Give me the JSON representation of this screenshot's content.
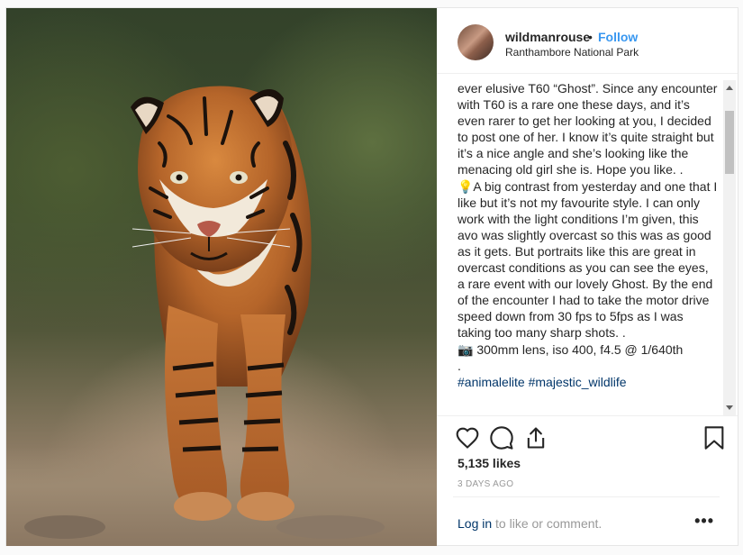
{
  "header": {
    "username": "wildmanrouse",
    "separator": "•",
    "follow_label": "Follow",
    "location": "Ranthambore National Park"
  },
  "caption": {
    "paragraph1": "ever elusive T60 “Ghost”. Since any encounter with T60 is a rare one these days, and it’s even rarer to get her looking at you, I decided to post one of her. I know it’s quite straight but it’s a nice angle and she’s looking like the menacing old girl she is. Hope you like. .",
    "paragraph2": "💡A big contrast from yesterday and one that I like but it’s not my favourite style. I can only work with the light conditions I’m given, this avo was slightly overcast so this was as good as it gets. But portraits like this are great in overcast conditions as you can see the eyes, a rare event with our lovely Ghost. By the end of the encounter I had to take the motor drive speed down from 30 fps to 5fps as I was taking too many sharp shots. .",
    "paragraph3": "📷 300mm lens, iso 400, f4.5 @ 1/640th",
    "paragraph4": ".",
    "hashtags": "#animalelite #majestic_wildlife"
  },
  "stats": {
    "likes": "5,135 likes",
    "date": "3 DAYS AGO"
  },
  "comment_bar": {
    "login_link": "Log in",
    "login_rest": " to like or comment.",
    "more_label": "•••"
  },
  "icons": [
    "heart-icon",
    "comment-icon",
    "share-icon",
    "bookmark-icon"
  ]
}
